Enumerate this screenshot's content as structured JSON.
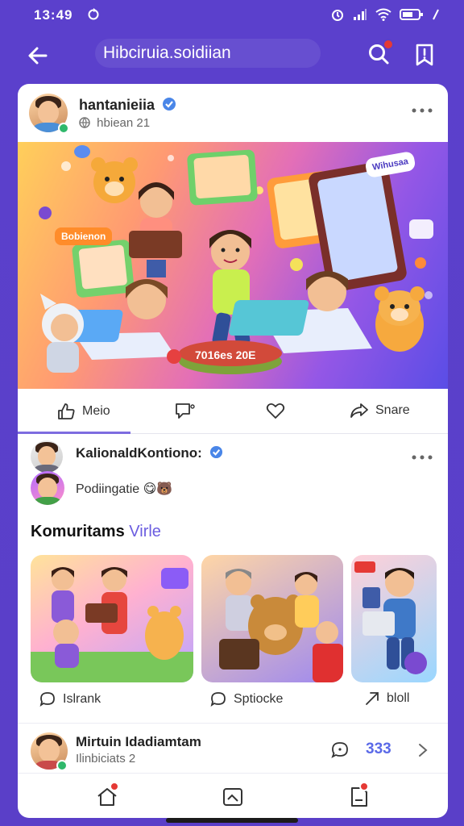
{
  "status_bar": {
    "time": "13:49"
  },
  "header": {
    "title": "Hibciruia.soidiian"
  },
  "post": {
    "author": "hantanieiia",
    "meta": "hbiean 21",
    "hero_caption": "7016es 20E",
    "hero_tag": "Bobienon",
    "hero_tag2": "Wihusaa"
  },
  "actions": [
    {
      "label": "Meio",
      "icon": "thumbs-up-icon"
    },
    {
      "label": "",
      "icon": "comment-icon"
    },
    {
      "label": "",
      "icon": "heart-icon"
    },
    {
      "label": "Snare",
      "icon": "share-icon"
    }
  ],
  "comments": [
    {
      "name": "KalionaldKontiono:",
      "text": ""
    },
    {
      "name": "",
      "text": "Podiingatie 😋🐻"
    }
  ],
  "section": {
    "title": "Komuritams",
    "accent": "Virle"
  },
  "thumbnails": [
    {
      "label": "Islrank",
      "icon": "comment-icon"
    },
    {
      "label": "Sptiocke",
      "icon": "comment-icon"
    },
    {
      "label": "bloll",
      "icon": "share-icon"
    }
  ],
  "bottom_user": {
    "name": "Mirtuin Idadiamtam",
    "meta": "Ilinbiciats 2",
    "count": "333"
  },
  "colors": {
    "accent": "#5a3fc8",
    "link": "#6b5de0",
    "badge": "#e53935",
    "verified": "#4a86e8"
  }
}
